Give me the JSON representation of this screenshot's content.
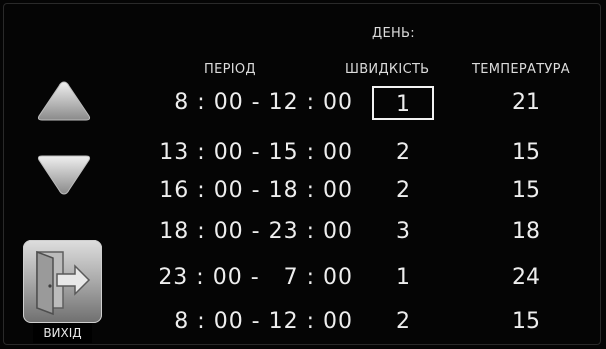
{
  "header": {
    "day_label": "ДЕНЬ:",
    "col_period": "ПЕРІОД",
    "col_speed": "ШВИДКІСТЬ",
    "col_temp": "ТЕМПЕРАТУРА"
  },
  "rows": [
    {
      "period": "8 : 00 - 12 : 00",
      "speed": "1",
      "temp": "21",
      "selected": true
    },
    {
      "period": "13 : 00 - 15 : 00",
      "speed": "2",
      "temp": "15"
    },
    {
      "period": "16 : 00 - 18 : 00",
      "speed": "2",
      "temp": "15"
    },
    {
      "period": "18 : 00 - 23 : 00",
      "speed": "3",
      "temp": "18"
    },
    {
      "period": "23 : 00 -   7 : 00",
      "speed": "1",
      "temp": "24"
    },
    {
      "period": "8 : 00 - 12 : 00",
      "speed": "2",
      "temp": "15"
    }
  ],
  "controls": {
    "up_icon": "arrow-up-icon",
    "down_icon": "arrow-down-icon",
    "exit_icon": "exit-door-icon",
    "exit_label": "ВИХІД"
  },
  "colors": {
    "background": "#050505",
    "text": "#eeeeee",
    "button_light": "#dedede",
    "button_dark": "#6f6f6f"
  }
}
